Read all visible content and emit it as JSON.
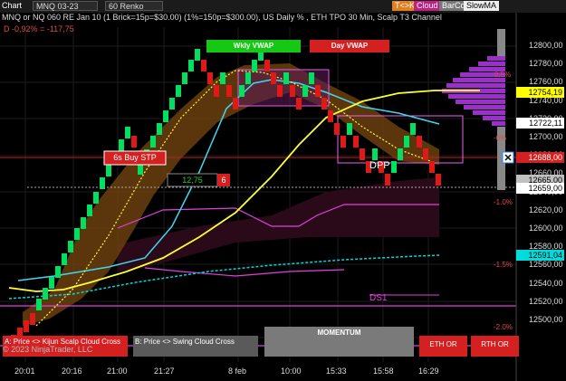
{
  "toolbar": {
    "chart_menu": "Chart",
    "instrument": "MNQ 03-23",
    "bar_type": "60 Renko",
    "btn_tc": "T<>K",
    "btn_cloud": "Cloud",
    "btn_barcol": "BarCol",
    "btn_slowma": "SlowMA"
  },
  "chart_title": "MNQ or NQ 060 RE Jan 10 (1 Brick=15p=$30.00) (1%=150p=$300.00), US Daily % , ETH TPO 30 Min, Scalp T3 Channel",
  "change_readout": "D -0,92% = -117,75",
  "labels": {
    "wkly_vwap": "Wkly VWAP",
    "day_vwap": "Day VWAP",
    "buy_stp": "6s Buy STP",
    "order_qty_price": "12,75",
    "order_qty": "6",
    "dpp": "DPP",
    "ds1": "DS1",
    "pct_top": "0,5%",
    "pct_0": "-0%",
    "pct_1": "-1.0%",
    "pct_15": "-1.5%",
    "pct_2": "-2.0%",
    "copyright": "© 2023 NinjaTrader, LLC"
  },
  "price_axis": {
    "ticks": [
      "12800,00",
      "12780,00",
      "12760,00",
      "12740,00",
      "12720,00",
      "12700,00",
      "12680,00",
      "12660,00",
      "12640,00",
      "12620,00",
      "12600,00",
      "12580,00",
      "12560,00",
      "12540,00",
      "12520,00",
      "12500,00"
    ],
    "price_labels": [
      {
        "text": "12754,19",
        "bg": "#ffff00",
        "fg": "#000000"
      },
      {
        "text": "12722,11",
        "bg": "#ffffff",
        "fg": "#000000"
      },
      {
        "text": "12688,00",
        "bg": "#d42020",
        "fg": "#ffffff"
      },
      {
        "text": "12665,00",
        "bg": "#c0c0c0",
        "fg": "#000000"
      },
      {
        "text": "12659,00",
        "bg": "#ffffff",
        "fg": "#000000"
      },
      {
        "text": "12591,04",
        "bg": "#00dcdc",
        "fg": "#000000"
      }
    ]
  },
  "time_axis": [
    "20:01",
    "20:16",
    "21:00",
    "21:27",
    "8 feb",
    "10:00",
    "15:33",
    "15:58",
    "16:29"
  ],
  "buttons": {
    "kijun": "A: Price <> Kijun Scalp Cloud Cross",
    "swing": "B: Price <> Swing Cloud Cross",
    "momentum": "MOMENTUM",
    "eth_or": "ETH OR",
    "rth_or": "RTH OR"
  },
  "colors": {
    "up_brick": "#00e060",
    "down_brick": "#e01818",
    "cloud": "#7a4a10",
    "profile": "#9b30c8",
    "yellow_ma": "#ffff30",
    "cyan_ma": "#40d8f0",
    "magenta": "#e040e0"
  }
}
